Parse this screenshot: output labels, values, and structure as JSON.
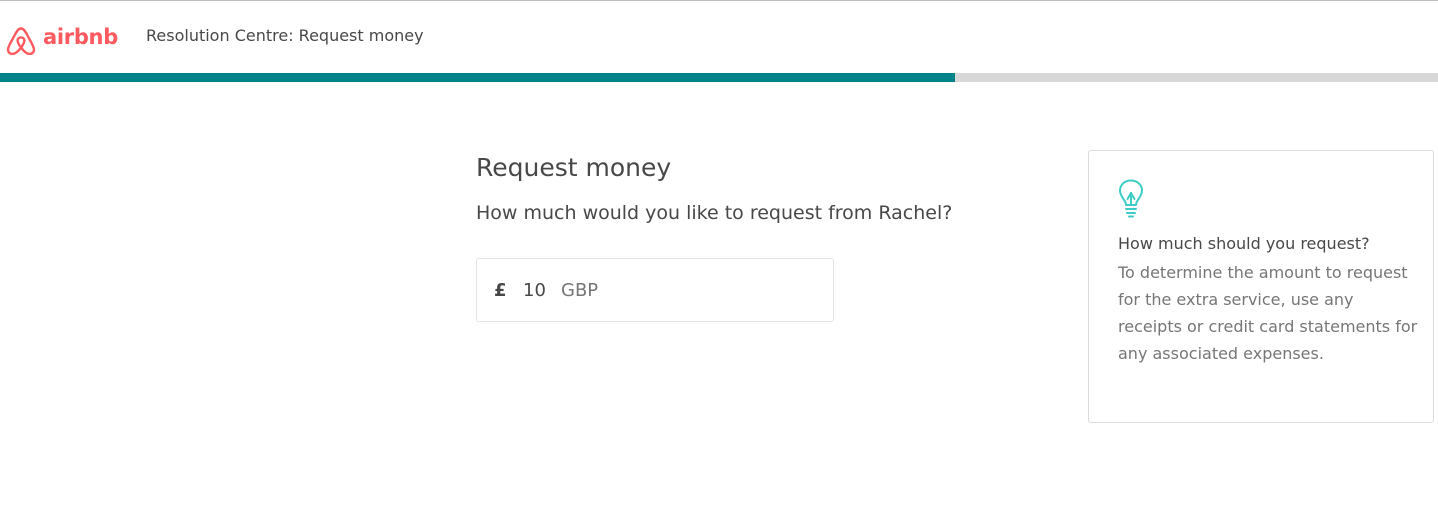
{
  "brand": {
    "wordmark": "airbnb",
    "logo_icon": "airbnb-belo-icon",
    "color": "#FF5A5F"
  },
  "header": {
    "title": "Resolution Centre: Request money"
  },
  "progress": {
    "fraction": 0.664,
    "fill_color": "#008489",
    "track_color": "#D8D8D8"
  },
  "main": {
    "heading": "Request money",
    "question": "How much would you like to request from Rachel?",
    "amount": {
      "currency_symbol": "£",
      "value": "10",
      "currency_code": "GBP"
    }
  },
  "tip": {
    "icon": "lightbulb-icon",
    "icon_color": "#3ECDC6",
    "heading": "How much should you request?",
    "body": "To determine the amount to request for the extra service, use any receipts or credit card statements for any associated expenses."
  }
}
